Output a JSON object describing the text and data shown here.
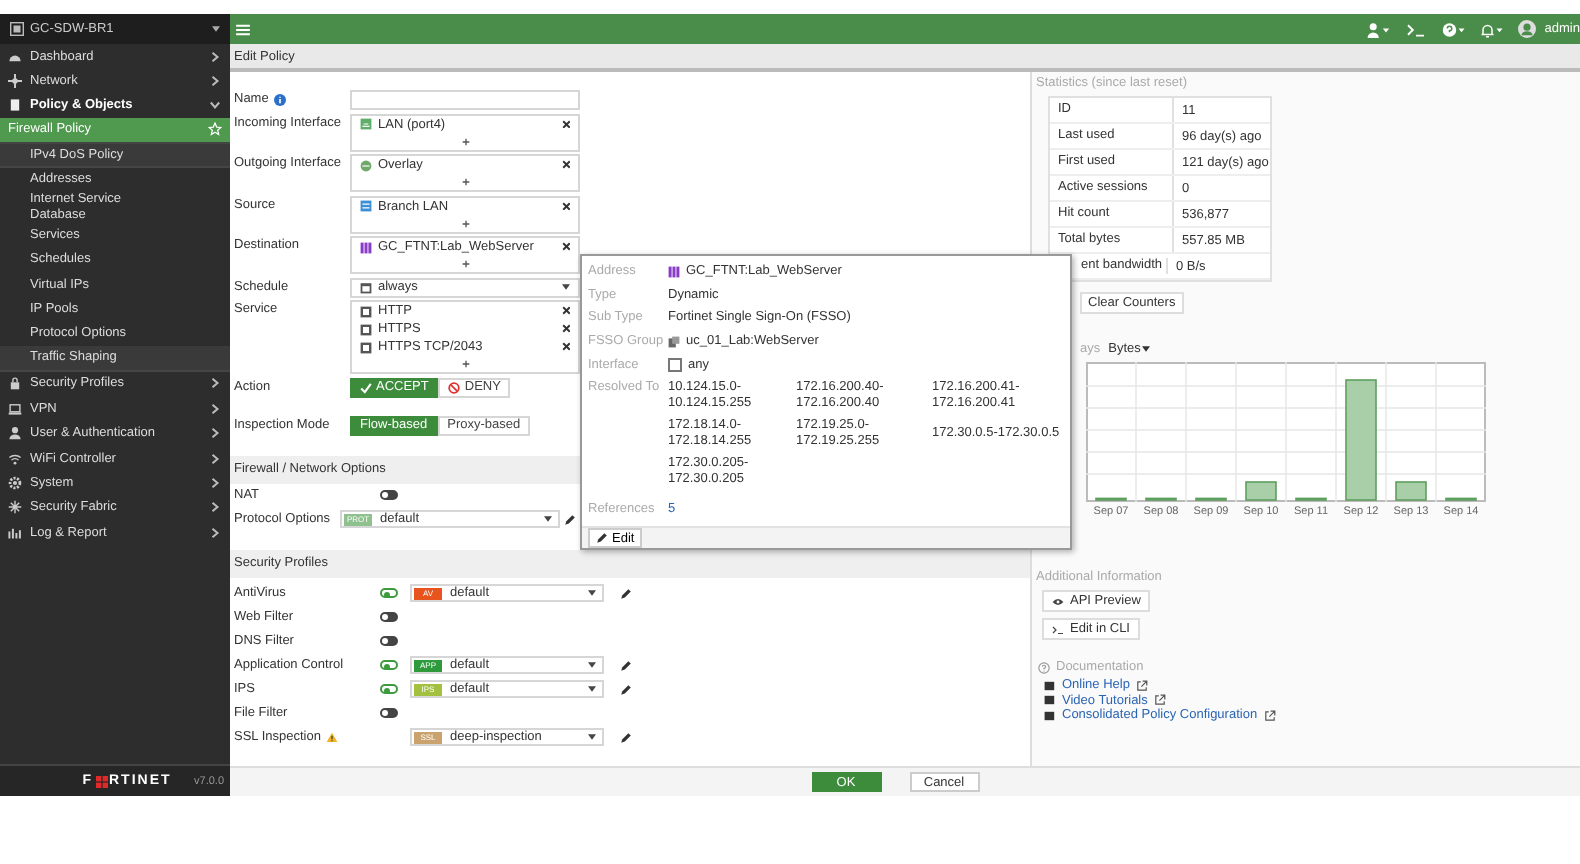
{
  "sidebar": {
    "device": "GC-SDW-BR1",
    "items": [
      {
        "label": "Dashboard",
        "expanded": false
      },
      {
        "label": "Network",
        "expanded": false
      },
      {
        "label": "Policy & Objects",
        "expanded": true,
        "children": [
          {
            "label": "Firewall Policy",
            "selected": true,
            "kind": "header"
          },
          {
            "label": "IPv4 DoS Policy",
            "selected": false,
            "kind": "header"
          },
          {
            "label": "Addresses",
            "selected": false,
            "kind": "link"
          },
          {
            "label": "Internet Service Database",
            "selected": false,
            "kind": "link"
          },
          {
            "label": "Services",
            "selected": false,
            "kind": "link"
          },
          {
            "label": "Schedules",
            "selected": false,
            "kind": "link"
          },
          {
            "label": "Virtual IPs",
            "selected": false,
            "kind": "link"
          },
          {
            "label": "IP Pools",
            "selected": false,
            "kind": "link"
          },
          {
            "label": "Protocol Options",
            "selected": false,
            "kind": "link"
          },
          {
            "label": "Traffic Shaping",
            "selected": false,
            "kind": "header"
          }
        ]
      },
      {
        "label": "Security Profiles",
        "expanded": false
      },
      {
        "label": "VPN",
        "expanded": false
      },
      {
        "label": "User & Authentication",
        "expanded": false
      },
      {
        "label": "WiFi Controller",
        "expanded": false
      },
      {
        "label": "System",
        "expanded": false
      },
      {
        "label": "Security Fabric",
        "expanded": false
      },
      {
        "label": "Log & Report",
        "expanded": false
      }
    ],
    "brand_start": "F",
    "brand_end": "RTINET",
    "version": "v7.0.0"
  },
  "topbar": {
    "user": "admin"
  },
  "breadcrumb": "Edit Policy",
  "form": {
    "name_label": "Name",
    "fields": [
      {
        "label": "Incoming Interface",
        "kind": "multi",
        "entries": [
          "LAN (port4)"
        ]
      },
      {
        "label": "Outgoing Interface",
        "kind": "multi",
        "entries": [
          "Overlay"
        ]
      },
      {
        "label": "Source",
        "kind": "multi",
        "entries": [
          "Branch LAN"
        ]
      },
      {
        "label": "Destination",
        "kind": "multi",
        "entries": [
          "GC_FTNT:Lab_WebServer"
        ]
      },
      {
        "label": "Schedule",
        "kind": "select",
        "value": "always"
      },
      {
        "label": "Service",
        "kind": "multi",
        "entries": [
          "HTTP",
          "HTTPS",
          "HTTPS TCP/2043"
        ]
      }
    ],
    "action": {
      "label": "Action",
      "options": [
        {
          "label": "ACCEPT",
          "selected": true
        },
        {
          "label": "DENY",
          "selected": false
        }
      ]
    },
    "inspection": {
      "label": "Inspection Mode",
      "options": [
        {
          "label": "Flow-based",
          "selected": true
        },
        {
          "label": "Proxy-based",
          "selected": false
        }
      ]
    },
    "network_section": "Firewall / Network Options",
    "nat": {
      "label": "NAT",
      "on": false
    },
    "protocol": {
      "label": "Protocol Options",
      "badge": "PROT",
      "color": "#8fc18f",
      "value": "default"
    },
    "security_section": "Security Profiles",
    "profiles": [
      {
        "label": "AntiVirus",
        "kind": "toggle",
        "on": true,
        "badge": "AV",
        "color": "#e8541e",
        "value": "default"
      },
      {
        "label": "Web Filter",
        "kind": "toggle",
        "on": false
      },
      {
        "label": "DNS Filter",
        "kind": "toggle",
        "on": false
      },
      {
        "label": "Application Control",
        "kind": "toggle",
        "on": true,
        "badge": "APP",
        "color": "#2e9a3c",
        "value": "default"
      },
      {
        "label": "IPS",
        "kind": "toggle",
        "on": true,
        "badge": "IPS",
        "color": "#a3c13e",
        "value": "default"
      },
      {
        "label": "File Filter",
        "kind": "toggle",
        "on": false
      },
      {
        "label": "SSL Inspection",
        "kind": "select",
        "warning": true,
        "badge": "SSL",
        "color": "#c9a26e",
        "value": "deep-inspection"
      }
    ]
  },
  "footer": {
    "buttons": [
      {
        "label": "OK",
        "kind": "primary"
      },
      {
        "label": "Cancel",
        "kind": "secondary"
      }
    ]
  },
  "popup": {
    "rows": [
      {
        "label": "Address",
        "kind": "address",
        "value": "GC_FTNT:Lab_WebServer"
      },
      {
        "label": "Type",
        "kind": "text",
        "value": "Dynamic"
      },
      {
        "label": "Sub Type",
        "kind": "text",
        "value": "Fortinet Single Sign-On (FSSO)"
      },
      {
        "label": "FSSO Group",
        "kind": "group",
        "value": "uc_01_Lab:WebServer"
      },
      {
        "label": "Interface",
        "kind": "checkbox",
        "checked": false,
        "value": "any"
      }
    ],
    "resolved_label": "Resolved To",
    "resolved": [
      "10.124.15.0-10.124.15.255",
      "172.16.200.40-172.16.200.40",
      "172.16.200.41-172.16.200.41",
      "172.18.14.0-172.18.14.255",
      "172.19.25.0-172.19.25.255",
      "172.30.0.5-172.30.0.5",
      "172.30.0.205-172.30.0.205"
    ],
    "references_label": "References",
    "references": "5",
    "edit": "Edit"
  },
  "stats": {
    "title": "Statistics (since last reset)",
    "rows": [
      {
        "label": "ID",
        "value": "11"
      },
      {
        "label": "Last used",
        "value": "96 day(s) ago"
      },
      {
        "label": "First used",
        "value": "121 day(s) ago"
      },
      {
        "label": "Active sessions",
        "value": "0"
      },
      {
        "label": "Hit count",
        "value": "536,877"
      },
      {
        "label": "Total bytes",
        "value": "557.85 MB"
      },
      {
        "label": "ent bandwidth",
        "value": "0 B/s"
      }
    ],
    "clear": "Clear Counters",
    "range": "ays",
    "metric": "Bytes",
    "chart_labels": [
      "Sep 07",
      "Sep 08",
      "Sep 09",
      "Sep 10",
      "Sep 11",
      "Sep 12",
      "Sep 13",
      "Sep 14"
    ]
  },
  "additional": {
    "title": "Additional Information",
    "buttons": [
      "API Preview",
      "Edit in CLI"
    ]
  },
  "documentation": {
    "title": "Documentation",
    "links": [
      "Online Help",
      "Video Tutorials",
      "Consolidated Policy Configuration"
    ]
  }
}
